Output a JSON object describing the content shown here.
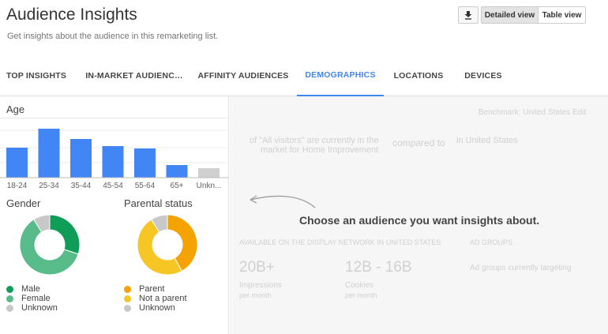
{
  "header": {
    "title": "Audience Insights",
    "subtitle": "Get insights about the audience in this remarketing list.",
    "detailed_view_label": "Detailed view",
    "table_view_label": "Table view",
    "download_icon": "download-icon"
  },
  "tabs": [
    {
      "label": "TOP INSIGHTS",
      "active": false
    },
    {
      "label": "IN-MARKET AUDIENC…",
      "active": false
    },
    {
      "label": "AFFINITY AUDIENCES",
      "active": false
    },
    {
      "label": "DEMOGRAPHICS",
      "active": true
    },
    {
      "label": "LOCATIONS",
      "active": false
    },
    {
      "label": "DEVICES",
      "active": false
    }
  ],
  "age": {
    "label": "Age",
    "chart_data": {
      "type": "bar",
      "categories": [
        "18-24",
        "25-34",
        "35-44",
        "45-54",
        "55-64",
        "65+",
        "Unkn..."
      ],
      "values": [
        38,
        62,
        49,
        40,
        37,
        16,
        12
      ],
      "ylim": [
        0,
        62
      ],
      "colors": [
        "#4285f4",
        "#4285f4",
        "#4285f4",
        "#4285f4",
        "#4285f4",
        "#4285f4",
        "#d0d0d0"
      ]
    }
  },
  "gender": {
    "label": "Gender",
    "chart_data": {
      "type": "pie",
      "labels": [
        "Male",
        "Female",
        "Unknown"
      ],
      "values": [
        30,
        61,
        9
      ],
      "colors": [
        "#0f9d58",
        "#57bb8a",
        "#c8c8c8"
      ]
    },
    "legend": [
      {
        "label": "Male",
        "color": "#0f9d58"
      },
      {
        "label": "Female",
        "color": "#57bb8a"
      },
      {
        "label": "Unknown",
        "color": "#c8c8c8"
      }
    ]
  },
  "parental": {
    "label": "Parental status",
    "chart_data": {
      "type": "pie",
      "labels": [
        "Parent",
        "Not a parent",
        "Unknown"
      ],
      "values": [
        42,
        49,
        9
      ],
      "colors": [
        "#f4a300",
        "#f6c624",
        "#c8c8c8"
      ]
    },
    "legend": [
      {
        "label": "Parent",
        "color": "#f4a300"
      },
      {
        "label": "Not a parent",
        "color": "#f6c624"
      },
      {
        "label": "Unknown",
        "color": "#c8c8c8"
      }
    ]
  },
  "right": {
    "prompt": "Choose an audience you want insights about.",
    "benchmark": "Benchmark: United States Edit",
    "all_visitors": "of \"All visitors\" are currently in the",
    "market_for": "market for Home Improvement",
    "compared_to": "compared to",
    "in_us": "in United States",
    "available": "AVAILABLE ON THE DISPLAY NETWORK IN UNITED STATES",
    "ad_groups_heading": "AD GROUPS",
    "impressions_value": "20B+",
    "impressions_label": "Impressions",
    "impressions_sub": "per month",
    "cookies_value": "12B - 16B",
    "cookies_label": "Cookies",
    "cookies_sub": "per month",
    "ad_groups_targeting": "Ad groups currently targeting"
  }
}
